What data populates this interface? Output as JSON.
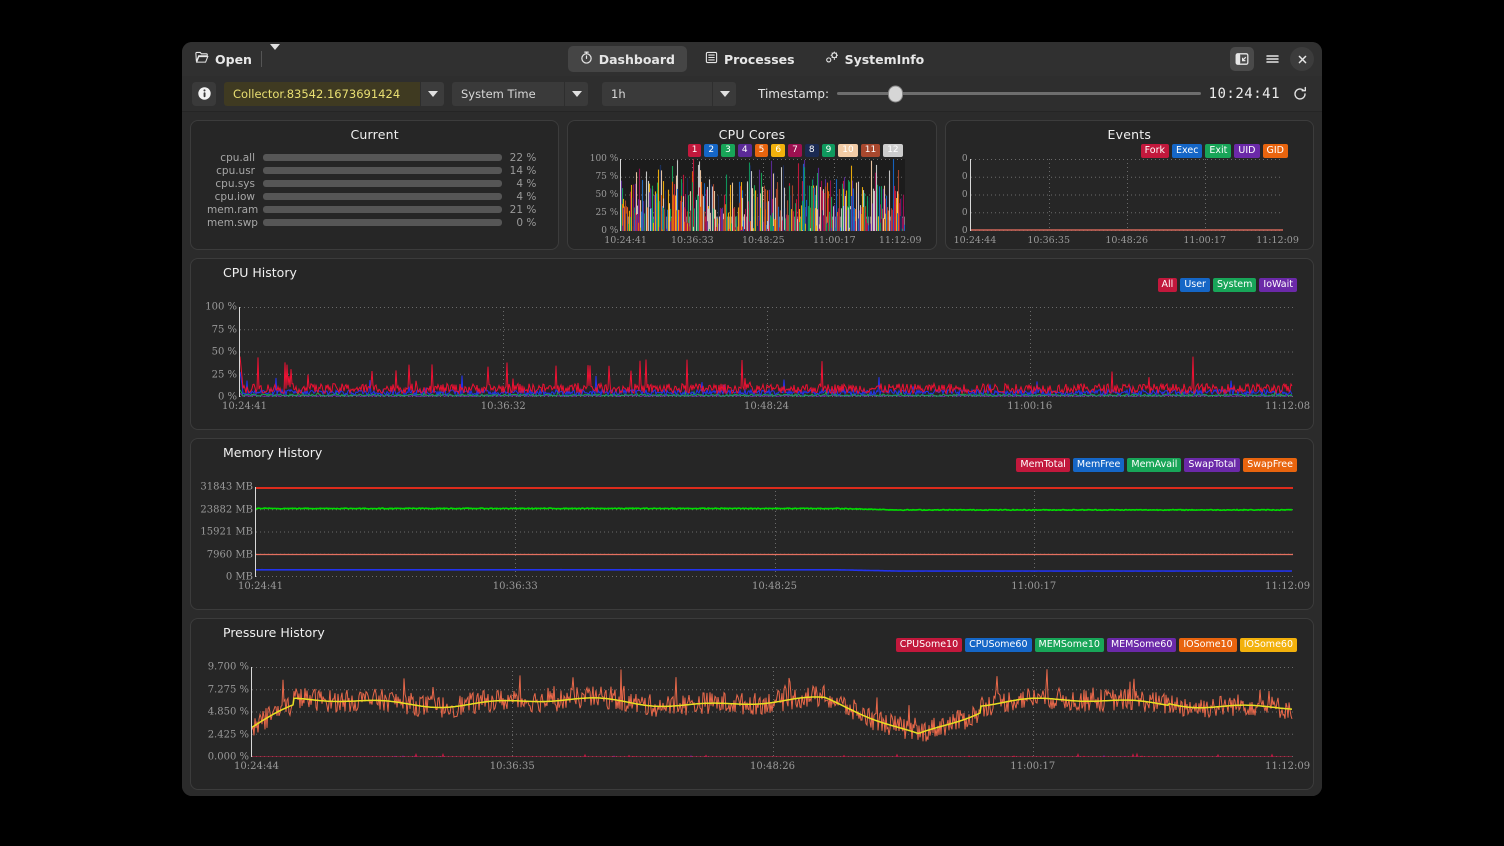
{
  "window": {
    "open_label": "Open",
    "open_icon": "folder-open-icon",
    "tabs": [
      {
        "label": "Dashboard",
        "icon": "stopwatch-icon",
        "active": true
      },
      {
        "label": "Processes",
        "icon": "list-icon",
        "active": false
      },
      {
        "label": "SystemInfo",
        "icon": "gears-icon",
        "active": false
      }
    ],
    "controls": [
      {
        "name": "panel-toggle",
        "icon": "sidebar-panel-icon",
        "selected": true
      },
      {
        "name": "menu",
        "icon": "hamburger-menu-icon",
        "selected": false
      },
      {
        "name": "close",
        "icon": "close-icon",
        "selected": false
      }
    ]
  },
  "toolbar": {
    "info_icon": "info-icon",
    "collector": "Collector.83542.1673691424",
    "time_mode": "System Time",
    "range": "1h",
    "timestamp_label": "Timestamp:",
    "clock": "10:24:41",
    "refresh_icon": "refresh-icon",
    "slider_position_pct": 14
  },
  "current": {
    "title": "Current",
    "rows": [
      {
        "label": "cpu.all",
        "value": 22,
        "text": "22 %"
      },
      {
        "label": "cpu.usr",
        "value": 14,
        "text": "14 %"
      },
      {
        "label": "cpu.sys",
        "value": 4,
        "text": "4 %"
      },
      {
        "label": "cpu.iow",
        "value": 4,
        "text": "4 %"
      },
      {
        "label": "mem.ram",
        "value": 21,
        "text": "21 %"
      },
      {
        "label": "mem.swp",
        "value": 0,
        "text": "0 %"
      }
    ]
  },
  "cpu_cores": {
    "title": "CPU Cores",
    "legend": [
      {
        "label": "1",
        "color": "#c2183c"
      },
      {
        "label": "2",
        "color": "#1566c6"
      },
      {
        "label": "3",
        "color": "#18a558"
      },
      {
        "label": "4",
        "color": "#5b2a97"
      },
      {
        "label": "5",
        "color": "#e8640e"
      },
      {
        "label": "6",
        "color": "#f2b10c"
      },
      {
        "label": "7",
        "color": "#9c1050"
      },
      {
        "label": "8",
        "color": "#1b2a52"
      },
      {
        "label": "9",
        "color": "#0f9a5e"
      },
      {
        "label": "10",
        "color": "#f2cba5",
        "text_color": "#ffffff"
      },
      {
        "label": "11",
        "color": "#a8482e"
      },
      {
        "label": "12",
        "color": "#cdcdcd",
        "text_color": "#ffffff"
      }
    ]
  },
  "events": {
    "title": "Events",
    "legend": [
      {
        "label": "Fork",
        "color": "#c2183c"
      },
      {
        "label": "Exec",
        "color": "#1566c6"
      },
      {
        "label": "Exit",
        "color": "#18a558"
      },
      {
        "label": "UID",
        "color": "#6b29a8"
      },
      {
        "label": "GID",
        "color": "#e8640e"
      }
    ]
  },
  "cpu_history": {
    "title": "CPU History",
    "legend": [
      {
        "label": "All",
        "color": "#c2183c"
      },
      {
        "label": "User",
        "color": "#1566c6"
      },
      {
        "label": "System",
        "color": "#18a558"
      },
      {
        "label": "IoWait",
        "color": "#6b29a8"
      }
    ]
  },
  "memory_history": {
    "title": "Memory History",
    "legend": [
      {
        "label": "MemTotal",
        "color": "#c2183c"
      },
      {
        "label": "MemFree",
        "color": "#1566c6"
      },
      {
        "label": "MemAvail",
        "color": "#18a558"
      },
      {
        "label": "SwapTotal",
        "color": "#6b29a8"
      },
      {
        "label": "SwapFree",
        "color": "#e8640e"
      }
    ]
  },
  "pressure_history": {
    "title": "Pressure History",
    "legend": [
      {
        "label": "CPUSome10",
        "color": "#c2183c"
      },
      {
        "label": "CPUSome60",
        "color": "#1566c6"
      },
      {
        "label": "MEMSome10",
        "color": "#18a558"
      },
      {
        "label": "MEMSome60",
        "color": "#6b29a8"
      },
      {
        "label": "IOSome10",
        "color": "#e8640e"
      },
      {
        "label": "IOSome60",
        "color": "#f2b10c"
      }
    ]
  },
  "chart_data": [
    {
      "id": "cpu_cores",
      "type": "line",
      "title": "CPU Cores",
      "ylabel": "",
      "xlabel": "",
      "yticks": [
        "100 %",
        "75 %",
        "50 %",
        "25 %",
        "0 %"
      ],
      "ylim": [
        0,
        100
      ],
      "xticks": [
        "10:24:41",
        "10:36:33",
        "10:48:25",
        "11:00:17",
        "11:12:09"
      ],
      "grid": true,
      "legend_position": "top-right",
      "series": [
        {
          "name": "1",
          "color": "#c2183c"
        },
        {
          "name": "2",
          "color": "#1566c6"
        },
        {
          "name": "3",
          "color": "#18a558"
        },
        {
          "name": "4",
          "color": "#5b2a97"
        },
        {
          "name": "5",
          "color": "#e8640e"
        },
        {
          "name": "6",
          "color": "#f2b10c"
        },
        {
          "name": "7",
          "color": "#9c1050"
        },
        {
          "name": "8",
          "color": "#1b2a52"
        },
        {
          "name": "9",
          "color": "#0f9a5e"
        },
        {
          "name": "10",
          "color": "#f2cba5"
        },
        {
          "name": "11",
          "color": "#a8482e"
        },
        {
          "name": "12",
          "color": "#cdcdcd"
        }
      ],
      "note": "Dense per-core utilization spikes spanning 0-100%, mean near 25%."
    },
    {
      "id": "events",
      "type": "line",
      "title": "Events",
      "yticks": [
        "0",
        "0",
        "0",
        "0",
        "0"
      ],
      "ylim": [
        0,
        0
      ],
      "xticks": [
        "10:24:44",
        "10:36:35",
        "10:48:26",
        "11:00:17",
        "11:12:09"
      ],
      "grid": true,
      "legend_position": "top-right",
      "series": [
        {
          "name": "Fork",
          "color": "#c2183c",
          "values": [
            0,
            0,
            0,
            0,
            0
          ]
        },
        {
          "name": "Exec",
          "color": "#1566c6",
          "values": [
            0,
            0,
            0,
            0,
            0
          ]
        },
        {
          "name": "Exit",
          "color": "#18a558",
          "values": [
            0,
            0,
            0,
            0,
            0
          ]
        },
        {
          "name": "UID",
          "color": "#6b29a8",
          "values": [
            0,
            0,
            0,
            0,
            0
          ]
        },
        {
          "name": "GID",
          "color": "#e8640e",
          "values": [
            0,
            0,
            0,
            0,
            0
          ]
        }
      ]
    },
    {
      "id": "cpu_history",
      "type": "line",
      "title": "CPU History",
      "yticks": [
        "100 %",
        "75 %",
        "50 %",
        "25 %",
        "0 %"
      ],
      "ylim": [
        0,
        100
      ],
      "xticks": [
        "10:24:41",
        "10:36:32",
        "10:48:24",
        "11:00:16",
        "11:12:08"
      ],
      "grid": true,
      "legend_position": "top-right",
      "series": [
        {
          "name": "All",
          "color": "#ee1133",
          "mean": 9,
          "peak": 45
        },
        {
          "name": "User",
          "color": "#2233ee",
          "mean": 5,
          "peak": 28
        },
        {
          "name": "System",
          "color": "#18a558",
          "mean": 2,
          "peak": 8
        },
        {
          "name": "IoWait",
          "color": "#6b29a8",
          "mean": 1,
          "peak": 4
        }
      ]
    },
    {
      "id": "memory_history",
      "type": "line",
      "title": "Memory History",
      "yticks": [
        "31843 MB",
        "23882 MB",
        "15921 MB",
        "7960 MB",
        "0 MB"
      ],
      "ylim": [
        0,
        31843
      ],
      "xticks": [
        "10:24:41",
        "10:36:33",
        "10:48:25",
        "11:00:17",
        "11:12:09"
      ],
      "grid": true,
      "legend_position": "top-right",
      "series": [
        {
          "name": "MemTotal",
          "color": "#dd2b1c",
          "constant": 31843
        },
        {
          "name": "MemAvail",
          "color": "#00dd00",
          "approx": 24200
        },
        {
          "name": "SwapTotal",
          "color": "#e4705f",
          "constant": 7960
        },
        {
          "name": "MemFree",
          "color": "#2233ee",
          "approx": 2500
        },
        {
          "name": "SwapFree",
          "color": "#e8640e",
          "approx": 7960
        }
      ]
    },
    {
      "id": "pressure_history",
      "type": "line",
      "title": "Pressure History",
      "yticks": [
        "9.700 %",
        "7.275 %",
        "4.850 %",
        "2.425 %",
        "0.000 %"
      ],
      "ylim": [
        0.0,
        9.7
      ],
      "xticks": [
        "10:24:44",
        "10:36:35",
        "10:48:26",
        "11:00:17",
        "11:12:09"
      ],
      "grid": true,
      "legend_position": "top-right",
      "series": [
        {
          "name": "IOSome10",
          "color": "#e8684a",
          "mean": 5.8,
          "peak": 9.7
        },
        {
          "name": "IOSome60",
          "color": "#e8e022",
          "mean": 5.9,
          "peak": 7.3
        },
        {
          "name": "CPUSome10",
          "color": "#c2183c",
          "mean": 0.05,
          "peak": 0.4
        },
        {
          "name": "CPUSome60",
          "color": "#1566c6",
          "mean": 0.0,
          "peak": 0.0
        },
        {
          "name": "MEMSome10",
          "color": "#18a558",
          "mean": 0.0,
          "peak": 0.0
        },
        {
          "name": "MEMSome60",
          "color": "#6b29a8",
          "mean": 0.02,
          "peak": 0.1
        }
      ]
    }
  ]
}
